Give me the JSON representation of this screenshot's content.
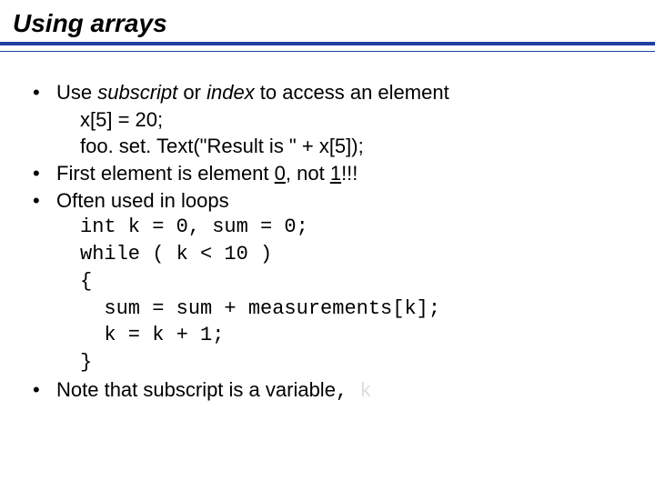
{
  "title": "Using arrays",
  "bullet1": {
    "pre": "Use ",
    "em1": "subscript",
    "mid": " or ",
    "em2": "index",
    "post": " to access an element"
  },
  "line_sub1": "x[5] = 20;",
  "line_sub2": "foo. set. Text(\"Result is \" + x[5]);",
  "bullet2": {
    "pre": "First element is element ",
    "zero": "0",
    "mid": ", not ",
    "one": "1",
    "post": "!!!"
  },
  "bullet3": "Often used in loops",
  "code": "int k = 0, sum = 0;\nwhile ( k < 10 )\n{\n  sum = sum + measurements[k];\n  k = k + 1;\n}",
  "bullet4": {
    "pre": "Note that subscript is a variable",
    "comma": ", ",
    "var": "k"
  }
}
